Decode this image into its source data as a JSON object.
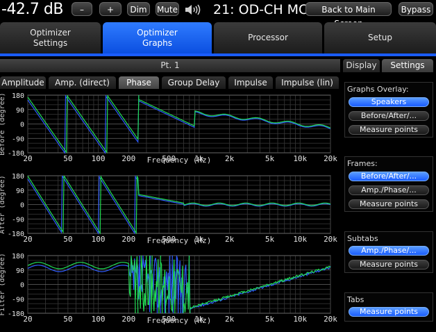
{
  "topbar": {
    "volume": "-42.7 dB",
    "minus": "–",
    "plus": "+",
    "dim": "Dim",
    "mute": "Mute",
    "speaker_icon": "speaker-volume-icon",
    "title": "21: OD-CH MC",
    "back": "Back to Main Screen",
    "bypass": "Bypass"
  },
  "main_tabs": [
    {
      "label1": "Optimizer",
      "label2": "Settings"
    },
    {
      "label1": "Optimizer",
      "label2": "Graphs"
    },
    {
      "label1": "Processor",
      "label2": ""
    },
    {
      "label1": "Setup",
      "label2": ""
    }
  ],
  "accent": "#1a5cff",
  "point_header": "Pt. 1",
  "side_tabs": {
    "display": "Display",
    "settings": "Settings"
  },
  "graph_tabs": [
    "Amplitude",
    "Amp. (direct)",
    "Phase",
    "Group Delay",
    "Impulse",
    "Impulse (lin)"
  ],
  "panel": {
    "graphs_overlay": {
      "title": "Graphs Overlay:",
      "buttons": [
        "Speakers",
        "Before/After/...",
        "Measure points"
      ]
    },
    "frames": {
      "title": "Frames:",
      "buttons": [
        "Before/After/...",
        "Amp./Phase/...",
        "Measure points"
      ]
    },
    "subtabs": {
      "title": "Subtabs",
      "buttons": [
        "Amp./Phase/...",
        "Measure points"
      ]
    },
    "tabs": {
      "title": "Tabs",
      "buttons": [
        "Measure points"
      ]
    }
  },
  "chart_data": [
    {
      "type": "line",
      "ylabel": "Before (degree)",
      "xlabel": "Frequency (Hz)",
      "x_ticks": [
        "20",
        "50",
        "100",
        "200",
        "500",
        "1k",
        "2k",
        "5k",
        "10k",
        "20k"
      ],
      "y_ticks": [
        "180",
        "90",
        "0",
        "-90",
        "-180"
      ],
      "ylim": [
        -180,
        180
      ],
      "xlim": [
        20,
        20000
      ],
      "x_scale": "log",
      "series_colors": [
        "#2e5bff",
        "#22dd55"
      ]
    },
    {
      "type": "line",
      "ylabel": "After (degree)",
      "xlabel": "Frequency (Hz)",
      "x_ticks": [
        "20",
        "50",
        "100",
        "200",
        "500",
        "1k",
        "2k",
        "5k",
        "10k",
        "20k"
      ],
      "y_ticks": [
        "180",
        "90",
        "0",
        "-90",
        "-180"
      ],
      "ylim": [
        -180,
        180
      ],
      "xlim": [
        20,
        20000
      ],
      "x_scale": "log",
      "series_colors": [
        "#2e5bff",
        "#22dd55"
      ]
    },
    {
      "type": "line",
      "ylabel": "Filter (degree)",
      "xlabel": "Frequency (Hz)",
      "x_ticks": [
        "20",
        "50",
        "100",
        "200",
        "500",
        "1k",
        "2k",
        "5k",
        "10k",
        "20k"
      ],
      "y_ticks": [
        "180",
        "90",
        "0",
        "-90",
        "-180"
      ],
      "ylim": [
        -180,
        180
      ],
      "xlim": [
        20,
        20000
      ],
      "x_scale": "log",
      "series_colors": [
        "#2e5bff",
        "#22dd55"
      ]
    }
  ]
}
